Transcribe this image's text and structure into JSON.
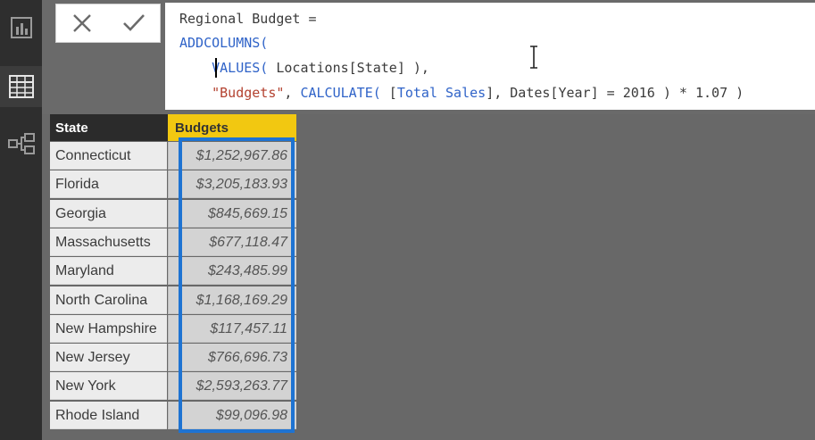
{
  "rail": {
    "items": [
      {
        "icon": "report-view-icon"
      },
      {
        "icon": "data-view-icon",
        "active": true
      },
      {
        "icon": "relationships-view-icon"
      }
    ]
  },
  "formula_bar": {
    "cancel_icon": "close-icon",
    "commit_icon": "checkmark-icon",
    "lines": [
      {
        "segments": [
          {
            "t": "Regional Budget =",
            "c": "plain"
          }
        ]
      },
      {
        "segments": [
          {
            "t": "ADDCOLUMNS(",
            "c": "kw"
          }
        ]
      },
      {
        "segments": [
          {
            "t": "    ",
            "c": "plain"
          },
          {
            "t": "VALUES(",
            "c": "kw"
          },
          {
            "t": " Locations[State] ),",
            "c": "plain"
          }
        ]
      },
      {
        "segments": [
          {
            "t": "    ",
            "c": "plain"
          },
          {
            "t": "\"Budgets\"",
            "c": "str"
          },
          {
            "t": ", ",
            "c": "plain"
          },
          {
            "t": "CALCULATE(",
            "c": "kw"
          },
          {
            "t": " [",
            "c": "plain"
          },
          {
            "t": "Total Sales",
            "c": "kw"
          },
          {
            "t": "], Dates[Year] = 2016 ) * 1.07 )",
            "c": "plain"
          }
        ]
      }
    ]
  },
  "table": {
    "columns": [
      "State",
      "Budgets"
    ],
    "rows": [
      {
        "state": "Connecticut",
        "budget": "$1,252,967.86"
      },
      {
        "state": "Florida",
        "budget": "$3,205,183.93"
      },
      {
        "state": "Georgia",
        "budget": "$845,669.15"
      },
      {
        "state": "Massachusetts",
        "budget": "$677,118.47"
      },
      {
        "state": "Maryland",
        "budget": "$243,485.99"
      },
      {
        "state": "North Carolina",
        "budget": "$1,168,169.29"
      },
      {
        "state": "New Hampshire",
        "budget": "$117,457.11"
      },
      {
        "state": "New Jersey",
        "budget": "$766,696.73"
      },
      {
        "state": "New York",
        "budget": "$2,593,263.77"
      },
      {
        "state": "Rhode Island",
        "budget": "$99,096.98"
      }
    ]
  },
  "colors": {
    "accent_header": "#f2c811",
    "highlight_border": "#1e73d2",
    "keyword": "#2f63c8",
    "string": "#b3412f"
  }
}
